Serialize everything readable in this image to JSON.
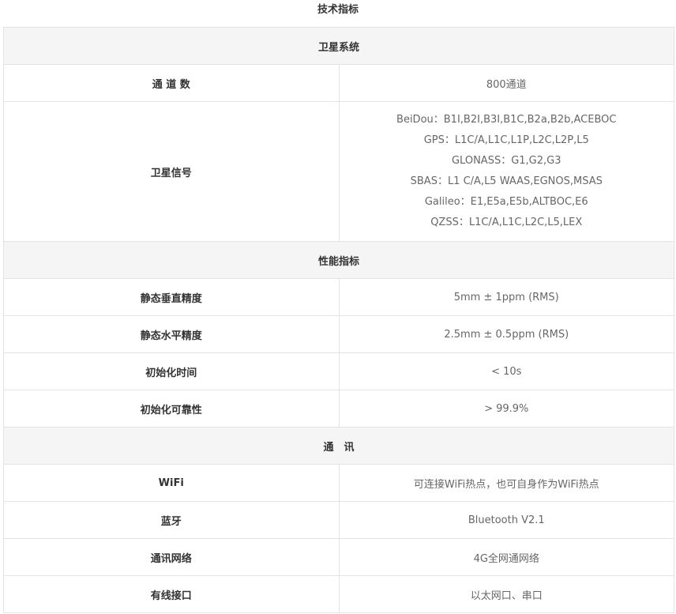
{
  "page_title": "技术指标",
  "sections": {
    "satellite": {
      "title": "卫星系统",
      "channels_label": "通 道 数",
      "channels_value": "800通道",
      "signals_label": "卫星信号",
      "signals": [
        "BeiDou：B1I,B2I,B3I,B1C,B2a,B2b,ACEBOC",
        "GPS：L1C/A,L1C,L1P,L2C,L2P,L5",
        "GLONASS：G1,G2,G3",
        "SBAS：L1 C/A,L5 WAAS,EGNOS,MSAS",
        "Galileo：E1,E5a,E5b,ALTBOC,E6",
        "QZSS：L1C/A,L1C,L2C,L5,LEX"
      ]
    },
    "performance": {
      "title": "性能指标",
      "rows": [
        {
          "label": "静态垂直精度",
          "value": "5mm ± 1ppm (RMS)"
        },
        {
          "label": "静态水平精度",
          "value": "2.5mm ± 0.5ppm (RMS)"
        },
        {
          "label": "初始化时间",
          "value": "< 10s"
        },
        {
          "label": "初始化可靠性",
          "value": "> 99.9%"
        }
      ]
    },
    "communication": {
      "title": "通　讯",
      "rows": [
        {
          "label": "WiFi",
          "value": "可连接WiFi热点，也可自身作为WiFi热点"
        },
        {
          "label": "蓝牙",
          "value": "Bluetooth V2.1"
        },
        {
          "label": "通讯网络",
          "value": "4G全网通网络"
        },
        {
          "label": "有线接口",
          "value": "以太网口、串口"
        }
      ]
    }
  }
}
